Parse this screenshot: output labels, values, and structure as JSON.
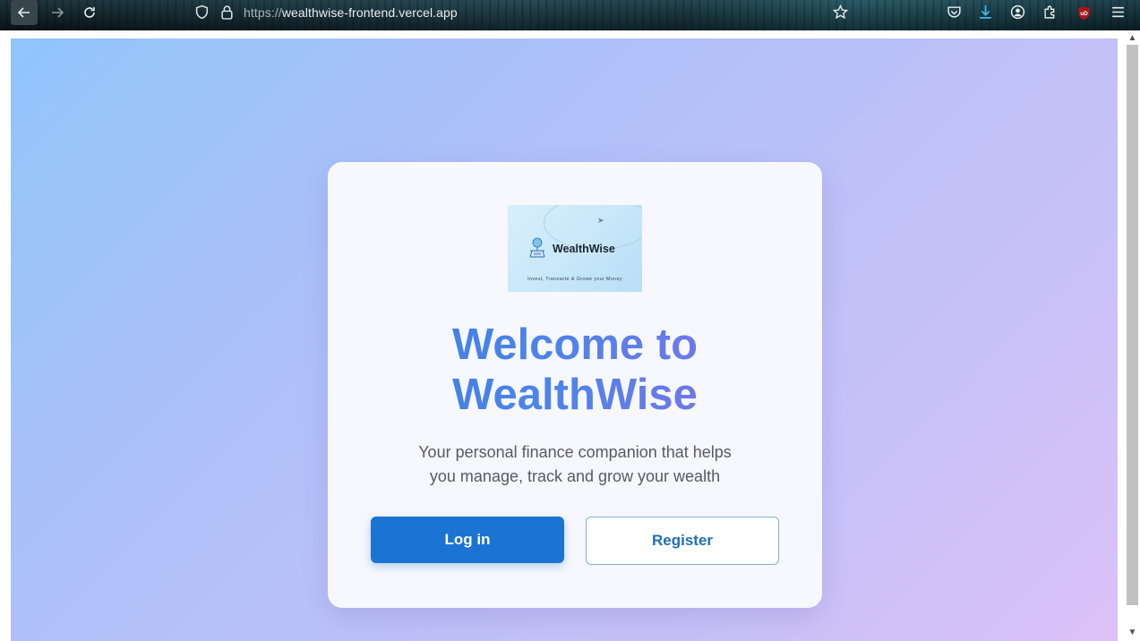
{
  "browser": {
    "url_protocol": "https://",
    "url_host": "wealthwise-frontend.vercel.app",
    "icons": [
      "back-arrow-icon",
      "forward-arrow-icon",
      "reload-icon",
      "shield-icon",
      "lock-icon",
      "bookmark-star-icon",
      "pocket-icon",
      "download-icon",
      "account-icon",
      "extensions-icon",
      "ublock-icon",
      "menu-icon"
    ]
  },
  "logo": {
    "name": "WealthWise",
    "tagline": "Invest, Transacte & Growe your Money"
  },
  "hero": {
    "title_line1": "Welcome to",
    "title_line2": "WealthWise",
    "subtitle_line1": "Your personal finance companion that helps",
    "subtitle_line2": "you manage, track and grow your wealth"
  },
  "actions": {
    "login_label": "Log in",
    "register_label": "Register"
  },
  "colors": {
    "primary": "#1b74d3",
    "title_gradient_start": "#3a7ee6",
    "title_gradient_end": "#8a6ee6",
    "background_start": "#90c5fb",
    "background_end": "#dcc1f8"
  }
}
